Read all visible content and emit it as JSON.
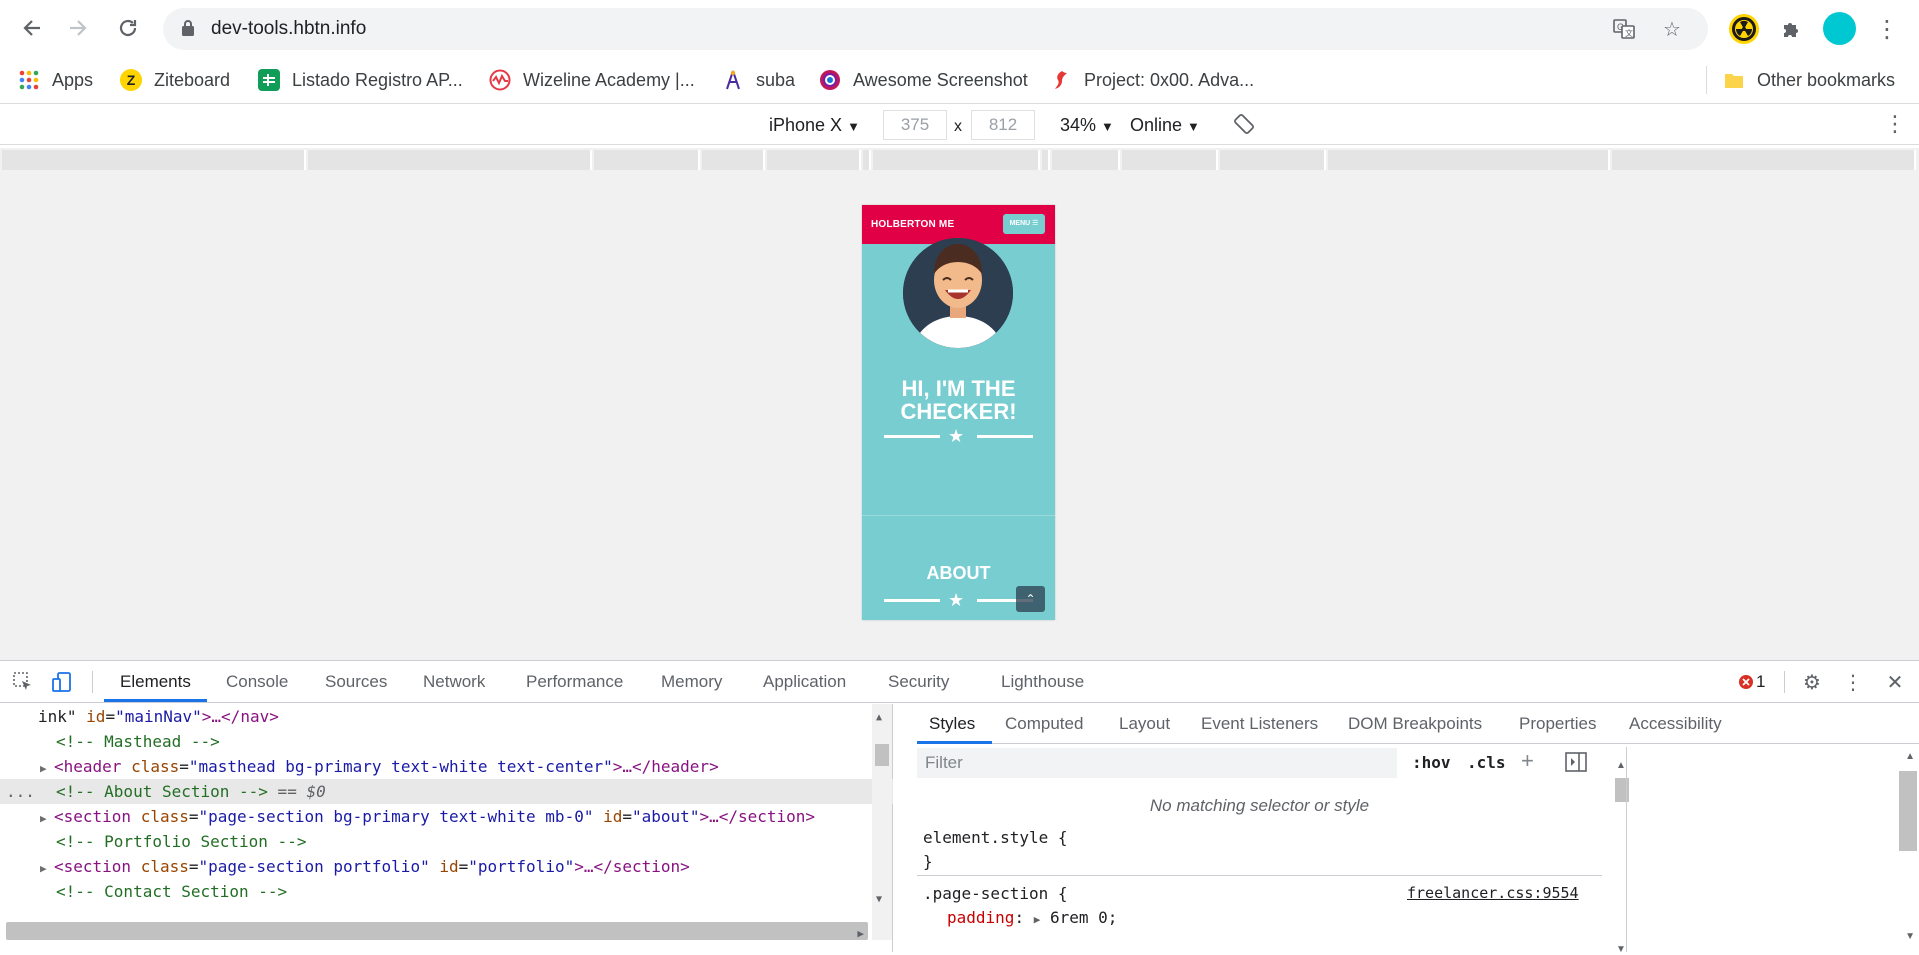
{
  "browser": {
    "url": "dev-tools.hbtn.info"
  },
  "bookmarks": {
    "items": [
      {
        "label": "Apps",
        "icon": "apps-grid-icon"
      },
      {
        "label": "Ziteboard",
        "icon": "ziteboard-icon"
      },
      {
        "label": "Listado Registro AP...",
        "icon": "sheets-icon"
      },
      {
        "label": "Wizeline Academy |...",
        "icon": "wizeline-icon"
      },
      {
        "label": "suba",
        "icon": "suba-icon"
      },
      {
        "label": "Awesome Screenshot",
        "icon": "awesome-screenshot-icon"
      },
      {
        "label": "Project: 0x00. Adva...",
        "icon": "holberton-icon"
      }
    ],
    "other": "Other bookmarks"
  },
  "device_toolbar": {
    "device": "iPhone X",
    "width": "375",
    "height": "812",
    "times": "x",
    "zoom": "34%",
    "network": "Online"
  },
  "phone": {
    "brand": "HOLBERTON ME",
    "menu": "MENU ☰",
    "heading_line1": "HI, I'M THE",
    "heading_line2": "CHECKER!",
    "about": "ABOUT",
    "scroll_top": "⌃"
  },
  "devtools": {
    "tabs": [
      "Elements",
      "Console",
      "Sources",
      "Network",
      "Performance",
      "Memory",
      "Application",
      "Security",
      "Lighthouse"
    ],
    "error_count": "1",
    "elements": {
      "line1_pre": "ink\"",
      "line1_attr": "id",
      "line1_val": "\"mainNav\"",
      "line1_tail": ">…</nav>",
      "line2": "<!-- Masthead -->",
      "line3_tag": "<header",
      "line3_attr": "class",
      "line3_val": "\"masthead bg-primary text-white text-center\"",
      "line3_tail": ">…</header>",
      "line4": "<!-- About Section -->",
      "line4_suffix": " == $0",
      "line4_dots": "...",
      "line5_tag": "<section",
      "line5_attr1": "class",
      "line5_val1": "\"page-section bg-primary text-white mb-0\"",
      "line5_attr2": "id",
      "line5_val2": "\"about\"",
      "line5_tail": ">…</section>",
      "line6": "<!-- Portfolio Section -->",
      "line7_tag": "<section",
      "line7_attr1": "class",
      "line7_val1": "\"page-section portfolio\"",
      "line7_attr2": "id",
      "line7_val2": "\"portfolio\"",
      "line7_tail": ">…</section>",
      "line8": "<!-- Contact Section -->"
    },
    "styles_tabs": [
      "Styles",
      "Computed",
      "Layout",
      "Event Listeners",
      "DOM Breakpoints",
      "Properties",
      "Accessibility"
    ],
    "filter_placeholder": "Filter",
    "hov": ":hov",
    "cls": ".cls",
    "no_match": "No matching selector or style",
    "element_style_open": "element.style {",
    "element_style_close": "}",
    "rule_selector": ".page-section {",
    "rule_source": "freelancer.css:9554",
    "rule_prop": "padding",
    "rule_value": "6rem 0;"
  },
  "colors": {
    "phone_nav": "#e10046",
    "phone_bg": "#78cdd1",
    "accent_blue": "#1a73e8"
  }
}
